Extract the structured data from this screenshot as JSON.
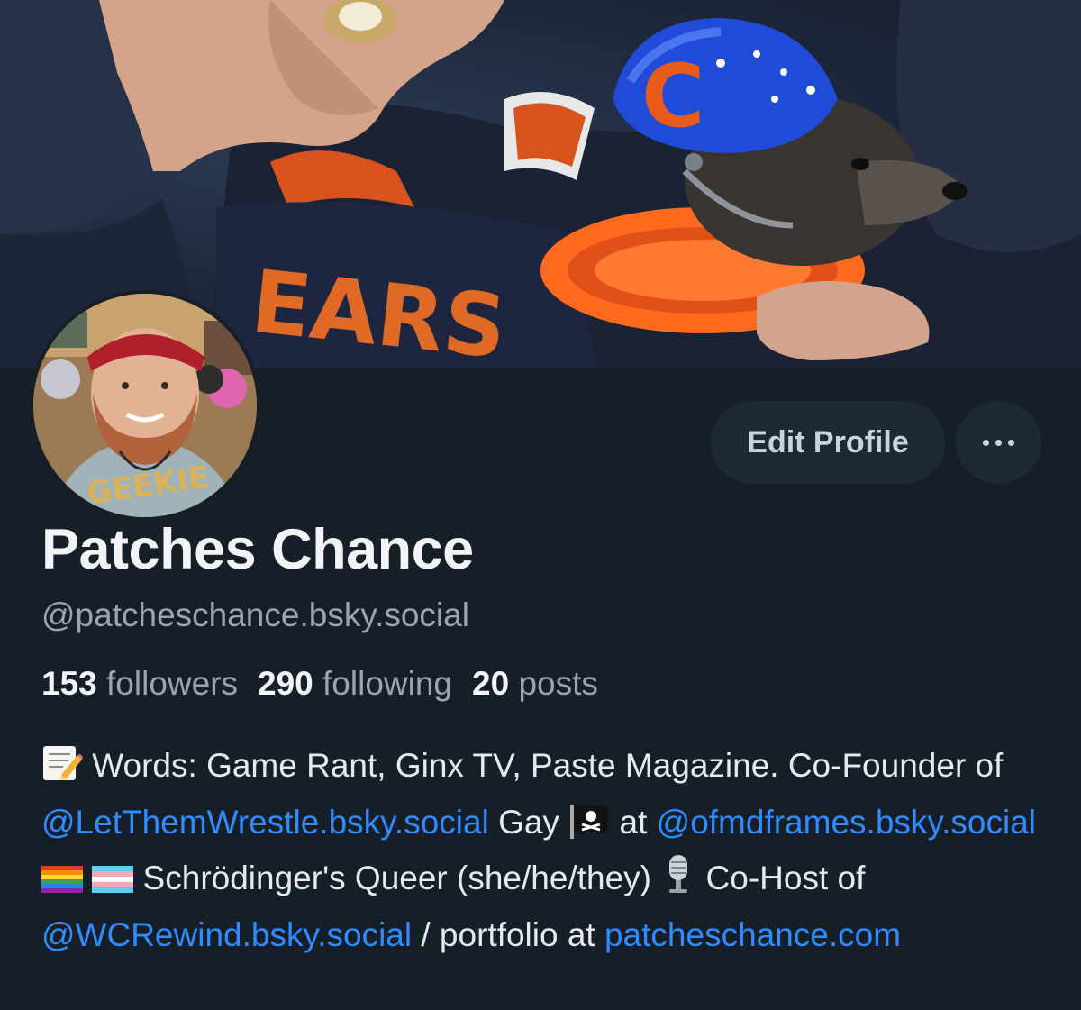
{
  "profile": {
    "name": "Patches Chance",
    "handle": "@patcheschance.bsky.social"
  },
  "actions": {
    "edit_profile": "Edit Profile",
    "more": "more-options"
  },
  "stats": {
    "followers_count": "153",
    "followers_label": "followers",
    "following_count": "290",
    "following_label": "following",
    "posts_count": "20",
    "posts_label": "posts"
  },
  "bio": {
    "seg1": " Words: Game Rant, Ginx TV, Paste Magazine. Co-Founder of ",
    "link1": "@LetThemWrestle.bsky.social",
    "seg2": " Gay ",
    "seg3": " at ",
    "link2": "@ofmdframes.bsky.social",
    "seg4": " Schrödinger's Queer (she/he/they) ",
    "seg5": " Co-Host of ",
    "link3": "@WCRewind.bsky.social",
    "seg6": " / portfolio at ",
    "link4": "patcheschance.com"
  },
  "colors": {
    "background": "#161e27",
    "button_bg": "#1e2936",
    "link": "#2f8cff",
    "muted_text": "#9aa5b2"
  },
  "icons": {
    "memo": "memo-icon",
    "pirate_flag": "pirate-flag-icon",
    "rainbow_flag": "rainbow-flag-icon",
    "trans_flag": "trans-flag-icon",
    "microphone": "microphone-icon"
  }
}
